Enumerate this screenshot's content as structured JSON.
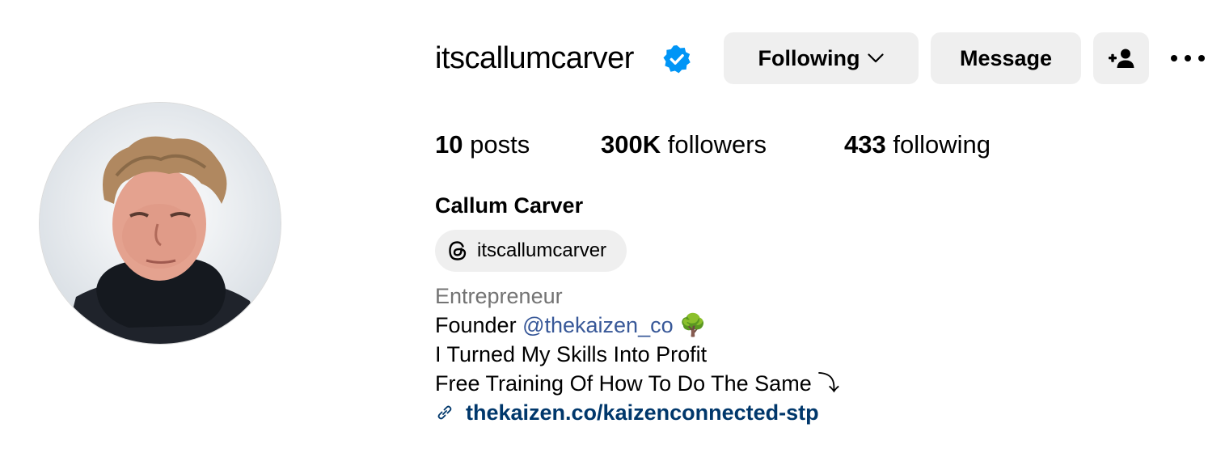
{
  "profile": {
    "username": "itscallumcarver",
    "verified": true,
    "full_name": "Callum Carver",
    "threads_handle": "itscallumcarver",
    "category": "Entrepreneur",
    "bio": {
      "founder_prefix": "Founder ",
      "founder_mention": "@thekaizen_co",
      "founder_emoji": "🌳",
      "line2": "I Turned My Skills Into Profit",
      "line3": "Free Training Of How To Do The Same ⤵"
    },
    "link": "thekaizen.co/kaizenconnected-stp"
  },
  "buttons": {
    "following": "Following",
    "message": "Message"
  },
  "stats": {
    "posts_count": "10",
    "posts_label": " posts",
    "followers_count": "300K",
    "followers_label": " followers",
    "following_count": "433",
    "following_label": " following"
  },
  "icons": {
    "verified": "verified-badge-icon",
    "following_chevron": "chevron-down-icon",
    "add_user": "add-user-icon",
    "more": "more-options-icon",
    "threads": "threads-icon",
    "link": "link-icon"
  },
  "colors": {
    "verified_blue": "#0095f6",
    "button_bg": "#efefef",
    "mention": "#385898",
    "link": "#00376b",
    "category": "#737373"
  }
}
